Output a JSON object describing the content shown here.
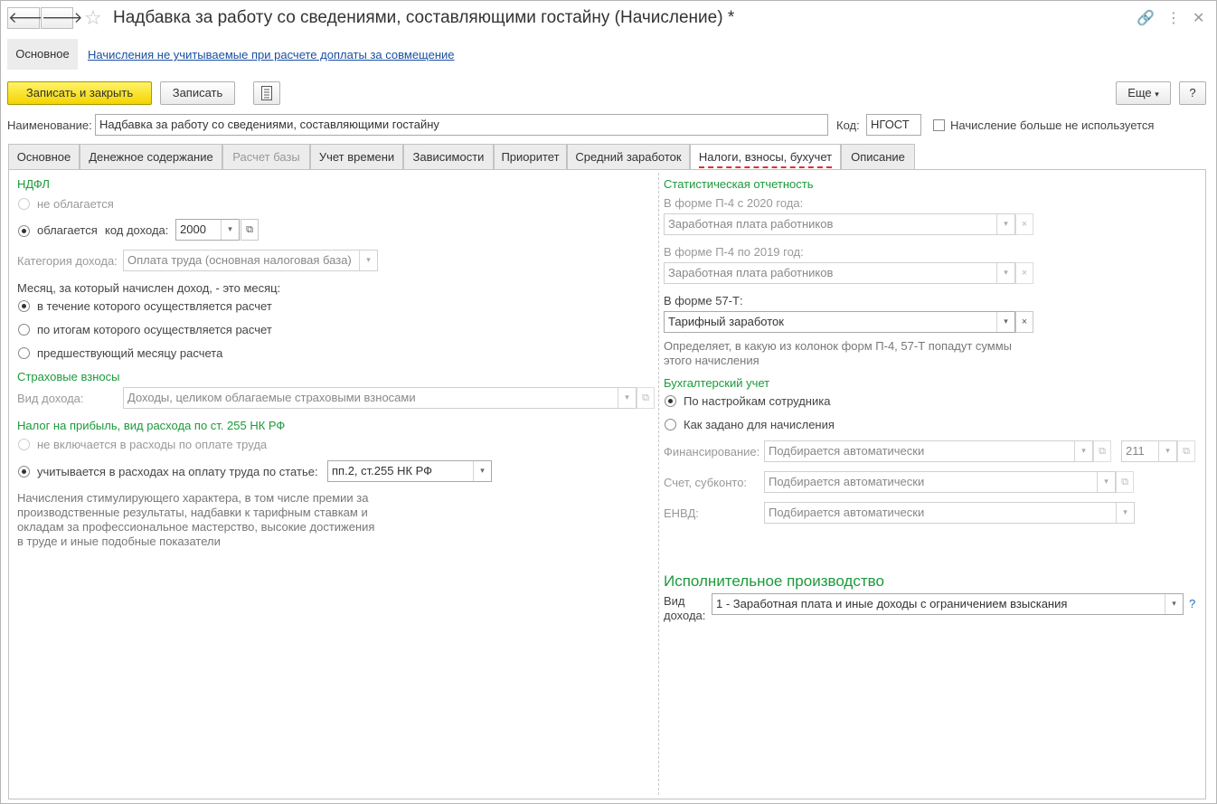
{
  "window": {
    "title": "Надбавка за работу со сведениями, составляющими гостайну (Начисление) *",
    "back_icon": "🡐",
    "forward_icon": "🡒"
  },
  "sections": {
    "main": "Основное",
    "link": "Начисления не учитываемые при расчете доплаты за совмещение"
  },
  "toolbar": {
    "save_close": "Записать и закрыть",
    "save": "Записать",
    "more": "Еще",
    "help": "?"
  },
  "header": {
    "name_label": "Наименование:",
    "name_value": "Надбавка за работу со сведениями, составляющими гостайну",
    "code_label": "Код:",
    "code_value": "НГОСТ",
    "unused_label": "Начисление больше не используется"
  },
  "tabs": [
    {
      "label": "Основное"
    },
    {
      "label": "Денежное содержание"
    },
    {
      "label": "Расчет базы"
    },
    {
      "label": "Учет времени"
    },
    {
      "label": "Зависимости"
    },
    {
      "label": "Приоритет"
    },
    {
      "label": "Средний заработок"
    },
    {
      "label": "Налоги, взносы, бухучет"
    },
    {
      "label": "Описание"
    }
  ],
  "ndfl": {
    "heading": "НДФЛ",
    "not_taxed": "не облагается",
    "taxed": "облагается",
    "income_code_label": "код дохода:",
    "income_code": "2000",
    "category_label": "Категория дохода:",
    "category_value": "Оплата труда (основная налоговая база)",
    "month_label": "Месяц, за который начислен доход, - это месяц:",
    "month_opt1": "в течение которого осуществляется расчет",
    "month_opt2": "по итогам которого осуществляется расчет",
    "month_opt3": "предшествующий месяцу расчета"
  },
  "insurance": {
    "heading": "Страховые взносы",
    "income_type_label": "Вид дохода:",
    "income_type_value": "Доходы, целиком облагаемые страховыми взносами"
  },
  "profit_tax": {
    "heading": "Налог на прибыль, вид расхода по ст. 255 НК РФ",
    "opt1": "не включается в расходы по оплате труда",
    "opt2": "учитывается в расходах на оплату труда по статье:",
    "article_value": "пп.2, ст.255 НК РФ",
    "note": [
      "Начисления стимулирующего характера, в том числе премии за",
      "производственные результаты, надбавки к тарифным ставкам и",
      "окладам за профессиональное мастерство, высокие достижения",
      "в труде и иные подобные показатели"
    ]
  },
  "statistics": {
    "heading": "Статистическая отчетность",
    "p4_2020_label": "В форме П-4 с 2020 года:",
    "p4_2020_value": "Заработная плата работников",
    "p4_2019_label": "В форме П-4 по 2019 год:",
    "p4_2019_value": "Заработная плата работников",
    "f57t_label": "В форме 57-Т:",
    "f57t_value": "Тарифный заработок",
    "note": [
      "Определяет, в какую из колонок форм П-4, 57-Т попадут суммы",
      "этого начисления"
    ]
  },
  "accounting": {
    "heading": "Бухгалтерский учет",
    "opt1": "По настройкам сотрудника",
    "opt2": "Как задано для начисления",
    "financing_label": "Финансирование:",
    "financing_value": "Подбирается автоматически",
    "financing_code": "211",
    "account_label": "Счет, субконто:",
    "account_value": "Подбирается автоматически",
    "envd_label": "ЕНВД:",
    "envd_value": "Подбирается автоматически"
  },
  "enforcement": {
    "heading": "Исполнительное производство",
    "label_line1": "Вид",
    "label_line2": "дохода:",
    "value": "1 - Заработная плата и иные доходы с ограничением взыскания",
    "help": "?"
  }
}
